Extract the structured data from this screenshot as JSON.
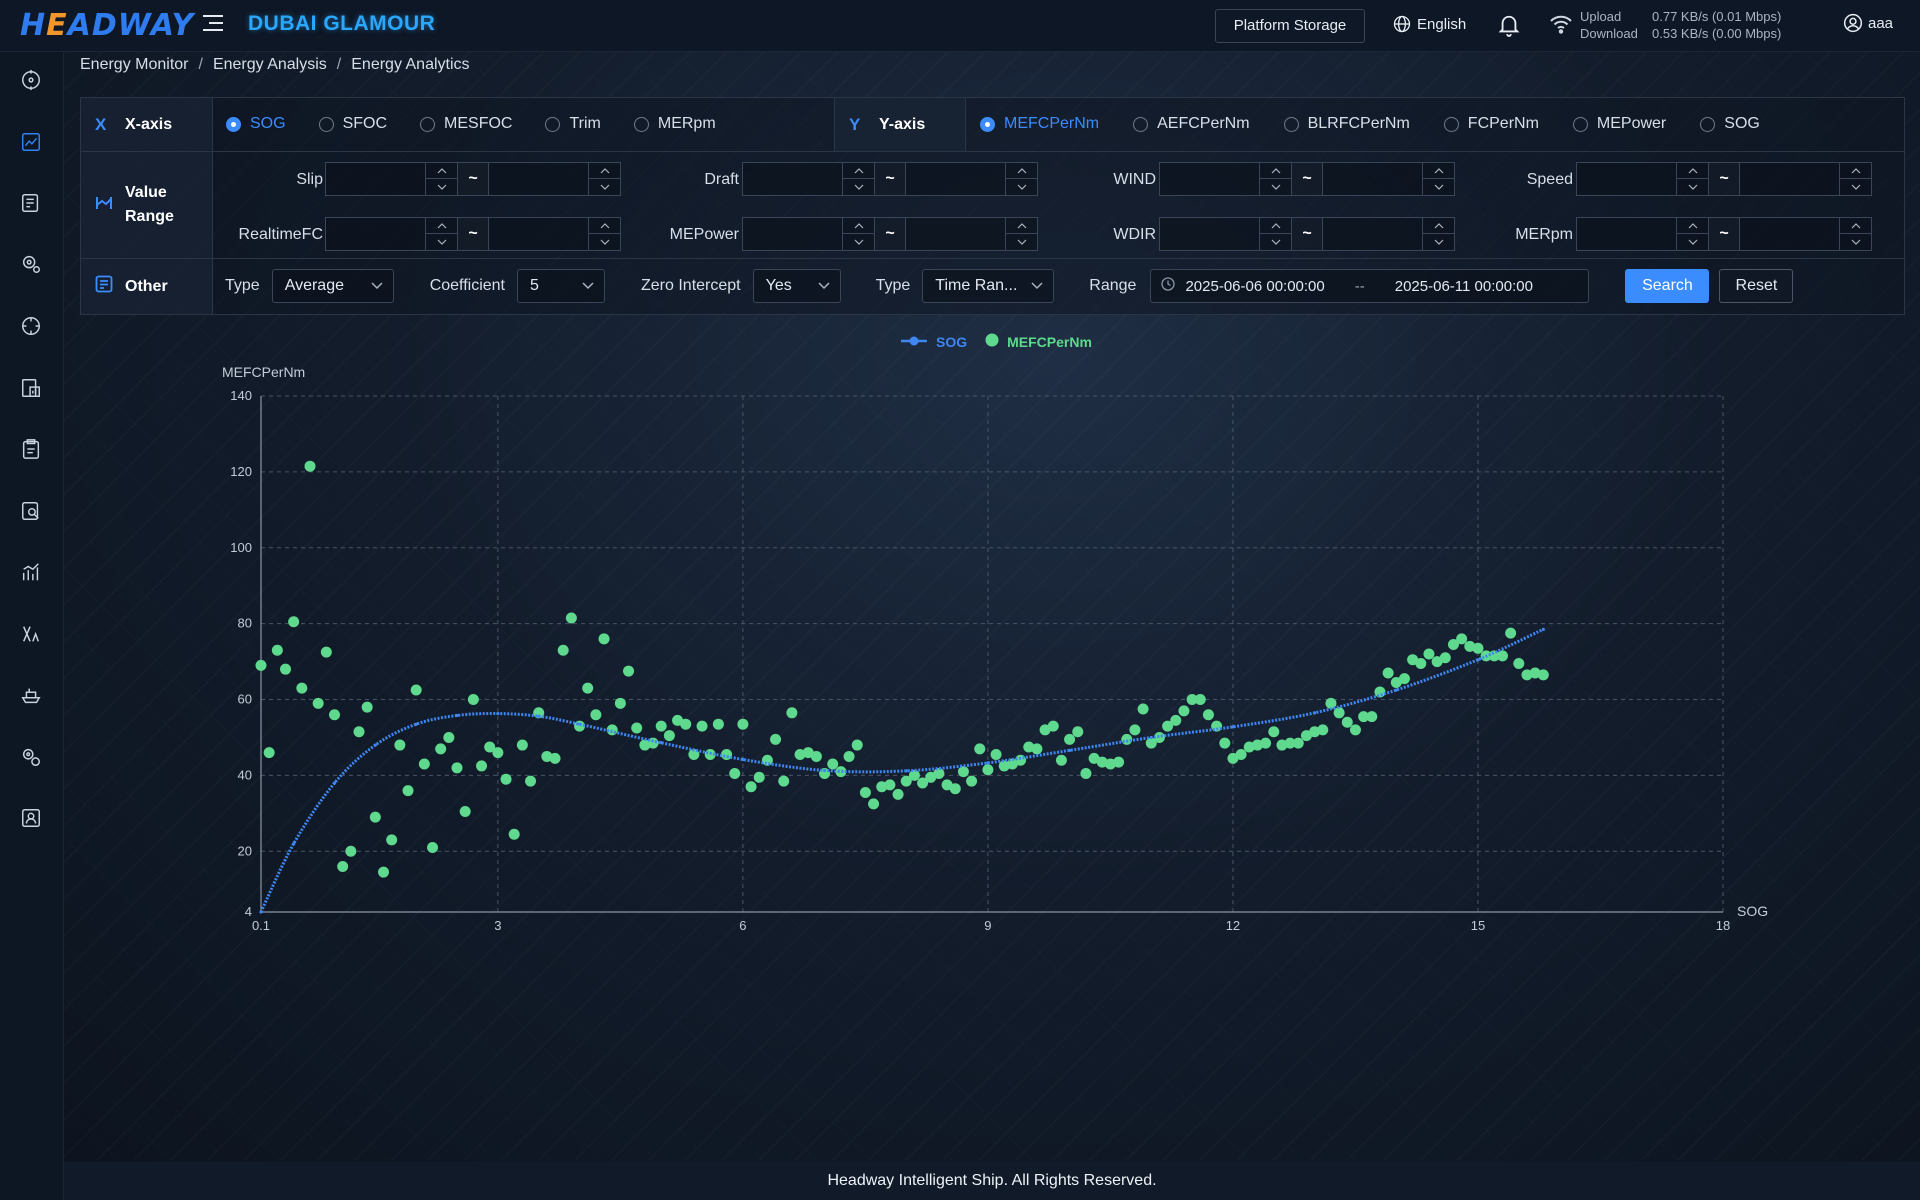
{
  "header": {
    "logo_text": "HEADWAY",
    "ship_name": "DUBAI GLAMOUR",
    "storage_button": "Platform Storage",
    "language": "English",
    "upload_label": "Upload",
    "upload_value": "0.77 KB/s (0.01 Mbps)",
    "download_label": "Download",
    "download_value": "0.53 KB/s (0.00 Mbps)",
    "user": "aaa"
  },
  "sidebar": {
    "items": [
      "crosshair-icon",
      "chart-icon",
      "report-icon",
      "settings-gear-icon",
      "target-icon",
      "document-chart-icon",
      "clipboard-icon",
      "search-document-icon",
      "bar-trend-icon",
      "tools-icon",
      "ship-icon",
      "gear-cluster-icon",
      "user-card-icon"
    ],
    "active_index": 1
  },
  "breadcrumb": [
    "Energy Monitor",
    "Energy Analysis",
    "Energy Analytics"
  ],
  "filters": {
    "x_axis": {
      "label": "X-axis",
      "icon": "X",
      "options": [
        "SOG",
        "SFOC",
        "MESFOC",
        "Trim",
        "MERpm"
      ],
      "selected": "SOG"
    },
    "y_axis": {
      "label": "Y-axis",
      "icon": "Y",
      "options": [
        "MEFCPerNm",
        "AEFCPerNm",
        "BLRFCPerNm",
        "FCPerNm",
        "MEPower",
        "SOG"
      ],
      "selected": "MEFCPerNm"
    },
    "value_range": {
      "label_line1": "Value",
      "label_line2": "Range",
      "fields_row1": [
        "Slip",
        "Draft",
        "WIND",
        "Speed"
      ],
      "fields_row2": [
        "RealtimeFC",
        "MEPower",
        "WDIR",
        "MERpm"
      ],
      "separator": "~"
    },
    "other": {
      "label": "Other",
      "type_label": "Type",
      "type_value": "Average",
      "coefficient_label": "Coefficient",
      "coefficient_value": "5",
      "zero_intercept_label": "Zero Intercept",
      "zero_intercept_value": "Yes",
      "type2_label": "Type",
      "type2_value": "Time Ran...",
      "range_label": "Range",
      "range_start": "2025-06-06 00:00:00",
      "range_separator": "--",
      "range_end": "2025-06-11 00:00:00",
      "search_button": "Search",
      "reset_button": "Reset"
    }
  },
  "colors": {
    "accent": "#3b8cff",
    "line_series": "#3f86f0",
    "scatter_series": "#5ed98d"
  },
  "chart_data": {
    "type": "scatter",
    "legend": [
      "SOG",
      "MEFCPerNm"
    ],
    "legend_position": "top-center",
    "xlabel": "SOG",
    "ylabel": "MEFCPerNm",
    "x_ticks": [
      "0.1",
      "3",
      "6",
      "9",
      "12",
      "15",
      "18"
    ],
    "y_ticks": [
      "4",
      "20",
      "40",
      "60",
      "80",
      "100",
      "120",
      "140"
    ],
    "xlim": [
      0.1,
      18
    ],
    "ylim": [
      4,
      140
    ],
    "grid": true,
    "series": [
      {
        "name": "SOG",
        "kind": "line",
        "x": [
          0.1,
          0.5,
          1.0,
          1.5,
          2.0,
          2.5,
          3.0,
          3.5,
          4.0,
          5.0,
          6.0,
          7.0,
          8.0,
          9.0,
          10.0,
          11.0,
          12.0,
          13.0,
          14.0,
          15.0,
          15.8
        ],
        "y": [
          4,
          22,
          38,
          48,
          53.5,
          55.8,
          56.3,
          55.6,
          53.5,
          48.6,
          44.2,
          41.3,
          41.2,
          43.3,
          46.6,
          50.0,
          52.8,
          56.5,
          62.5,
          70.5,
          78.5
        ]
      },
      {
        "name": "MEFCPerNm",
        "kind": "scatter",
        "points": [
          [
            0.1,
            69
          ],
          [
            0.2,
            46
          ],
          [
            0.3,
            73
          ],
          [
            0.4,
            68
          ],
          [
            0.5,
            80.5
          ],
          [
            0.6,
            63
          ],
          [
            0.7,
            121.5
          ],
          [
            0.8,
            59
          ],
          [
            0.9,
            72.5
          ],
          [
            1.0,
            56
          ],
          [
            1.1,
            16
          ],
          [
            1.2,
            20
          ],
          [
            1.3,
            51.5
          ],
          [
            1.4,
            58
          ],
          [
            1.5,
            29
          ],
          [
            1.6,
            14.5
          ],
          [
            1.7,
            23
          ],
          [
            1.8,
            48
          ],
          [
            1.9,
            36
          ],
          [
            2.0,
            62.5
          ],
          [
            2.1,
            43
          ],
          [
            2.2,
            21
          ],
          [
            2.3,
            47
          ],
          [
            2.4,
            50
          ],
          [
            2.5,
            42
          ],
          [
            2.6,
            30.5
          ],
          [
            2.7,
            60
          ],
          [
            2.8,
            42.5
          ],
          [
            2.9,
            47.5
          ],
          [
            3.0,
            46
          ],
          [
            3.1,
            39
          ],
          [
            3.2,
            24.5
          ],
          [
            3.3,
            48
          ],
          [
            3.4,
            38.5
          ],
          [
            3.5,
            56.5
          ],
          [
            3.6,
            45
          ],
          [
            3.7,
            44.5
          ],
          [
            3.8,
            73
          ],
          [
            3.9,
            81.5
          ],
          [
            4.0,
            53
          ],
          [
            4.1,
            63
          ],
          [
            4.2,
            56
          ],
          [
            4.3,
            76
          ],
          [
            4.4,
            52
          ],
          [
            4.5,
            59
          ],
          [
            4.6,
            67.5
          ],
          [
            4.7,
            52.5
          ],
          [
            4.8,
            48
          ],
          [
            4.9,
            48.5
          ],
          [
            5.0,
            53
          ],
          [
            5.1,
            50.5
          ],
          [
            5.2,
            54.5
          ],
          [
            5.3,
            53.5
          ],
          [
            5.4,
            45.5
          ],
          [
            5.5,
            53
          ],
          [
            5.6,
            45.5
          ],
          [
            5.7,
            53.5
          ],
          [
            5.8,
            45.5
          ],
          [
            6.0,
            53.5
          ],
          [
            5.9,
            40.5
          ],
          [
            6.1,
            37
          ],
          [
            6.2,
            39.5
          ],
          [
            6.3,
            44
          ],
          [
            6.4,
            49.5
          ],
          [
            6.5,
            38.5
          ],
          [
            6.6,
            56.5
          ],
          [
            6.7,
            45.5
          ],
          [
            6.8,
            46
          ],
          [
            6.9,
            45
          ],
          [
            7.0,
            40.5
          ],
          [
            7.1,
            43
          ],
          [
            7.2,
            41
          ],
          [
            7.3,
            45
          ],
          [
            7.4,
            48
          ],
          [
            7.5,
            35.5
          ],
          [
            7.6,
            32.5
          ],
          [
            7.7,
            37
          ],
          [
            7.8,
            37.5
          ],
          [
            7.9,
            35
          ],
          [
            8.0,
            38.5
          ],
          [
            8.1,
            40
          ],
          [
            8.2,
            38
          ],
          [
            8.3,
            39.5
          ],
          [
            8.4,
            40.5
          ],
          [
            8.5,
            37.5
          ],
          [
            8.6,
            36.5
          ],
          [
            8.7,
            41
          ],
          [
            8.8,
            38.5
          ],
          [
            8.9,
            47
          ],
          [
            9.0,
            41.5
          ],
          [
            9.1,
            45.5
          ],
          [
            9.2,
            42.5
          ],
          [
            9.3,
            43
          ],
          [
            9.4,
            44
          ],
          [
            9.5,
            47.5
          ],
          [
            9.6,
            47
          ],
          [
            9.7,
            52
          ],
          [
            9.8,
            53
          ],
          [
            9.9,
            44
          ],
          [
            10.0,
            49.5
          ],
          [
            10.1,
            51.5
          ],
          [
            10.2,
            40.5
          ],
          [
            10.3,
            44.5
          ],
          [
            10.4,
            43.5
          ],
          [
            10.5,
            43
          ],
          [
            10.6,
            43.5
          ],
          [
            10.7,
            49.5
          ],
          [
            10.8,
            52
          ],
          [
            10.9,
            57.5
          ],
          [
            11.0,
            48.5
          ],
          [
            11.1,
            50
          ],
          [
            11.2,
            53
          ],
          [
            11.3,
            54.5
          ],
          [
            11.4,
            57
          ],
          [
            11.5,
            60
          ],
          [
            11.6,
            60
          ],
          [
            11.7,
            56
          ],
          [
            11.8,
            53
          ],
          [
            11.9,
            48.5
          ],
          [
            12.0,
            44.5
          ],
          [
            12.1,
            45.5
          ],
          [
            12.2,
            47.5
          ],
          [
            12.3,
            48
          ],
          [
            12.4,
            48.5
          ],
          [
            12.5,
            51.5
          ],
          [
            12.6,
            48
          ],
          [
            12.7,
            48.5
          ],
          [
            12.8,
            48.5
          ],
          [
            12.9,
            50.5
          ],
          [
            13.0,
            51.5
          ],
          [
            13.1,
            52
          ],
          [
            13.2,
            59
          ],
          [
            13.3,
            56.5
          ],
          [
            13.4,
            54
          ],
          [
            13.5,
            52
          ],
          [
            13.6,
            55.5
          ],
          [
            13.7,
            55.5
          ],
          [
            13.8,
            62
          ],
          [
            13.9,
            67
          ],
          [
            14.0,
            64.5
          ],
          [
            14.1,
            65.5
          ],
          [
            14.2,
            70.5
          ],
          [
            14.3,
            69.5
          ],
          [
            14.4,
            72
          ],
          [
            14.5,
            70
          ],
          [
            14.6,
            71
          ],
          [
            14.7,
            74.5
          ],
          [
            14.8,
            76
          ],
          [
            14.9,
            74
          ],
          [
            15.0,
            73.5
          ],
          [
            15.1,
            71.5
          ],
          [
            15.2,
            71.5
          ],
          [
            15.3,
            71.5
          ],
          [
            15.4,
            77.5
          ],
          [
            15.5,
            69.5
          ],
          [
            15.6,
            66.5
          ],
          [
            15.7,
            67
          ],
          [
            15.8,
            66.5
          ]
        ]
      }
    ]
  },
  "footer": "Headway Intelligent Ship. All Rights Reserved."
}
